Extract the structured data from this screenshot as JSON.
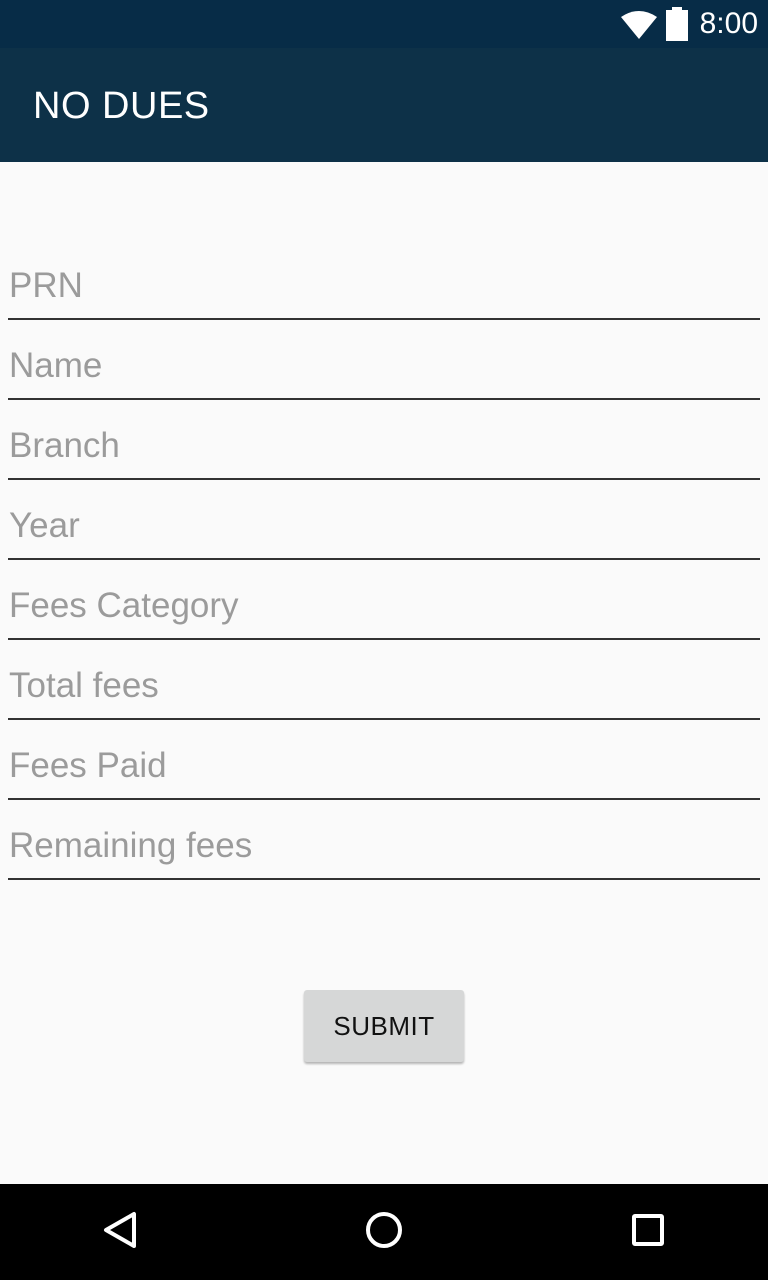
{
  "status_bar": {
    "time": "8:00",
    "icons": [
      "wifi-icon",
      "battery-icon"
    ]
  },
  "app_bar": {
    "title": "NO DUES"
  },
  "form": {
    "fields": [
      {
        "placeholder": "PRN",
        "value": ""
      },
      {
        "placeholder": "Name",
        "value": ""
      },
      {
        "placeholder": "Branch",
        "value": ""
      },
      {
        "placeholder": "Year",
        "value": ""
      },
      {
        "placeholder": "Fees Category",
        "value": ""
      },
      {
        "placeholder": "Total fees",
        "value": ""
      },
      {
        "placeholder": "Fees Paid",
        "value": ""
      },
      {
        "placeholder": "Remaining fees",
        "value": ""
      }
    ],
    "submit_label": "SUBMIT"
  },
  "nav_bar": {
    "icons": [
      "back-icon",
      "home-icon",
      "recents-icon"
    ]
  },
  "colors": {
    "status_bar": "#072c47",
    "app_bar": "#0d3148",
    "background": "#fafafa",
    "button": "#d6d7d7",
    "placeholder": "#9b9b9b"
  }
}
